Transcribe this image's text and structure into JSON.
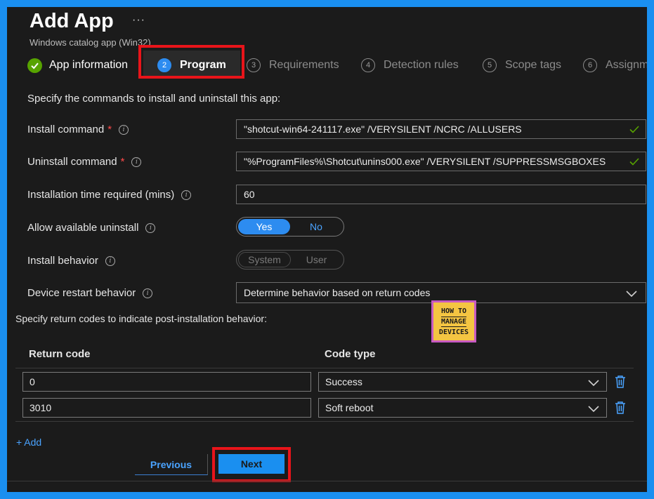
{
  "header": {
    "title": "Add App",
    "more": "···",
    "subtitle": "Windows catalog app (Win32)"
  },
  "steps": [
    {
      "num": "✓",
      "label": "App information",
      "state": "done"
    },
    {
      "num": "2",
      "label": "Program",
      "state": "active"
    },
    {
      "num": "3",
      "label": "Requirements",
      "state": "pending"
    },
    {
      "num": "4",
      "label": "Detection rules",
      "state": "pending"
    },
    {
      "num": "5",
      "label": "Scope tags",
      "state": "pending"
    },
    {
      "num": "6",
      "label": "Assignm",
      "state": "pending"
    }
  ],
  "form": {
    "instructions": "Specify the commands to install and uninstall this app:",
    "install_command": {
      "label": "Install command",
      "required": "*",
      "value": "\"shotcut-win64-241117.exe\" /VERYSILENT /NCRC /ALLUSERS"
    },
    "uninstall_command": {
      "label": "Uninstall command",
      "required": "*",
      "value": "\"%ProgramFiles%\\Shotcut\\unins000.exe\" /VERYSILENT /SUPPRESSMSGBOXES"
    },
    "install_time": {
      "label": "Installation time required (mins)",
      "value": "60"
    },
    "allow_uninstall": {
      "label": "Allow available uninstall",
      "yes": "Yes",
      "no": "No",
      "selected": "Yes"
    },
    "install_behavior": {
      "label": "Install behavior",
      "system": "System",
      "user": "User"
    },
    "restart_behavior": {
      "label": "Device restart behavior",
      "value": "Determine behavior based on return codes"
    }
  },
  "return_codes": {
    "intro": "Specify return codes to indicate post-installation behavior:",
    "col_code": "Return code",
    "col_type": "Code type",
    "rows": [
      {
        "code": "0",
        "type": "Success"
      },
      {
        "code": "3010",
        "type": "Soft reboot"
      }
    ],
    "add_label": "+ Add"
  },
  "logo": {
    "line1": "HOW TO",
    "line2": "MANAGE",
    "line3": "DEVICES"
  },
  "footer": {
    "previous": "Previous",
    "next": "Next"
  },
  "colors": {
    "accent": "#2d8cf0",
    "highlight": "#e8141a",
    "success": "#57a300",
    "frame": "#1a8ff0"
  }
}
